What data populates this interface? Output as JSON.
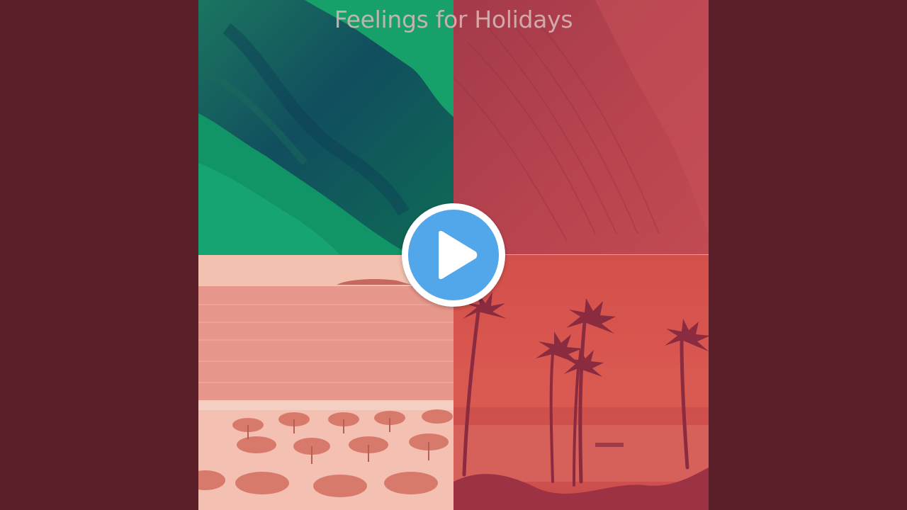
{
  "video": {
    "cover_title": "Feelings for Holidays"
  },
  "controls": {
    "play_icon": "play-icon",
    "play_color": "#52a6ea"
  },
  "colors": {
    "background": "#5a1f28",
    "green_tile": "#128a62",
    "dune_tile": "#b2414d",
    "beach_tile": "#eeb3a4",
    "palm_tile": "#d6504c"
  }
}
